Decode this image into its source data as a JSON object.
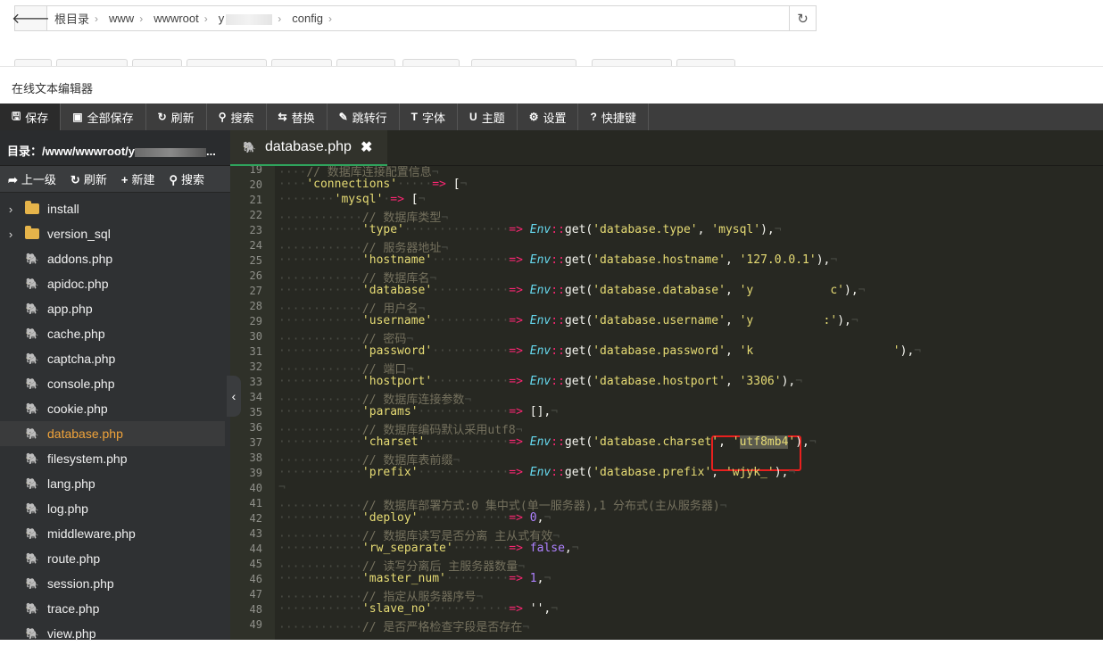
{
  "address_bar": {
    "breadcrumbs": [
      "根目录",
      "www",
      "wwwroot",
      "y",
      "config"
    ]
  },
  "modal": {
    "title": "在线文本编辑器"
  },
  "toolbar": {
    "buttons": [
      {
        "icon": "save-icon",
        "glyph": "🖫",
        "label": "保存"
      },
      {
        "icon": "save-all-icon",
        "glyph": "▣",
        "label": "全部保存"
      },
      {
        "icon": "refresh-icon",
        "glyph": "↻",
        "label": "刷新"
      },
      {
        "icon": "search-icon",
        "glyph": "⚲",
        "label": "搜索"
      },
      {
        "icon": "replace-icon",
        "glyph": "⇆",
        "label": "替换"
      },
      {
        "icon": "jump-icon",
        "glyph": "✎",
        "label": "跳转行"
      },
      {
        "icon": "font-icon",
        "glyph": "T",
        "label": "字体"
      },
      {
        "icon": "theme-icon",
        "glyph": "U",
        "label": "主题"
      },
      {
        "icon": "settings-icon",
        "glyph": "⚙",
        "label": "设置"
      },
      {
        "icon": "shortcut-icon",
        "glyph": "?",
        "label": "快捷键"
      }
    ]
  },
  "sidebar": {
    "dir_label": "目录：/www/wwwroot/y",
    "dir_ellipsis": "...",
    "actions": [
      {
        "icon": "up-icon",
        "glyph": "➦",
        "label": "上一级"
      },
      {
        "icon": "refresh-icon",
        "glyph": "↻",
        "label": "刷新"
      },
      {
        "icon": "plus-icon",
        "glyph": "+",
        "label": "新建"
      },
      {
        "icon": "search-icon",
        "glyph": "⚲",
        "label": "搜索"
      }
    ],
    "files": [
      {
        "name": "install",
        "type": "folder"
      },
      {
        "name": "version_sql",
        "type": "folder"
      },
      {
        "name": "addons.php",
        "type": "php"
      },
      {
        "name": "apidoc.php",
        "type": "php"
      },
      {
        "name": "app.php",
        "type": "php"
      },
      {
        "name": "cache.php",
        "type": "php"
      },
      {
        "name": "captcha.php",
        "type": "php"
      },
      {
        "name": "console.php",
        "type": "php"
      },
      {
        "name": "cookie.php",
        "type": "php"
      },
      {
        "name": "database.php",
        "type": "php",
        "selected": true
      },
      {
        "name": "filesystem.php",
        "type": "php"
      },
      {
        "name": "lang.php",
        "type": "php"
      },
      {
        "name": "log.php",
        "type": "php"
      },
      {
        "name": "middleware.php",
        "type": "php"
      },
      {
        "name": "route.php",
        "type": "php"
      },
      {
        "name": "session.php",
        "type": "php"
      },
      {
        "name": "trace.php",
        "type": "php"
      },
      {
        "name": "view.php",
        "type": "php"
      }
    ]
  },
  "editor": {
    "tab": {
      "label": "database.php",
      "close": "✖"
    },
    "highlighted_value": "utf8mb4",
    "lines": [
      {
        "n": "19",
        "indent": 4,
        "cm": "// 数据库连接配置信息"
      },
      {
        "n": "20",
        "indent": 4,
        "key": "'connections'",
        "pad": 5,
        "open": "["
      },
      {
        "n": "21",
        "indent": 8,
        "key": "'mysql'",
        "pad": 1,
        "open": "["
      },
      {
        "n": "22",
        "indent": 12,
        "cm": "// 数据库类型"
      },
      {
        "n": "23",
        "indent": 12,
        "key": "'type'",
        "pad": 15,
        "env": "database.type",
        "def": "'mysql'"
      },
      {
        "n": "24",
        "indent": 12,
        "cm": "// 服务器地址"
      },
      {
        "n": "25",
        "indent": 12,
        "key": "'hostname'",
        "pad": 11,
        "env": "database.hostname",
        "def": "'127.0.0.1'"
      },
      {
        "n": "26",
        "indent": 12,
        "cm": "// 数据库名"
      },
      {
        "n": "27",
        "indent": 12,
        "key": "'database'",
        "pad": 11,
        "env": "database.database",
        "def": "'y           c'"
      },
      {
        "n": "28",
        "indent": 12,
        "cm": "// 用户名"
      },
      {
        "n": "29",
        "indent": 12,
        "key": "'username'",
        "pad": 11,
        "env": "database.username",
        "def": "'y          :'"
      },
      {
        "n": "30",
        "indent": 12,
        "cm": "// 密码"
      },
      {
        "n": "31",
        "indent": 12,
        "key": "'password'",
        "pad": 11,
        "env": "database.password",
        "def": "'k                    '"
      },
      {
        "n": "32",
        "indent": 12,
        "cm": "// 端口"
      },
      {
        "n": "33",
        "indent": 12,
        "key": "'hostport'",
        "pad": 11,
        "env": "database.hostport",
        "def": "'3306'"
      },
      {
        "n": "34",
        "indent": 12,
        "cm": "// 数据库连接参数"
      },
      {
        "n": "35",
        "indent": 12,
        "key": "'params'",
        "pad": 13,
        "raw": "[],"
      },
      {
        "n": "36",
        "indent": 12,
        "cm": "// 数据库编码默认采用utf8"
      },
      {
        "n": "37",
        "indent": 12,
        "key": "'charset'",
        "pad": 12,
        "env": "database.charset",
        "def": "'utf8mb4'",
        "highlight": true
      },
      {
        "n": "38",
        "indent": 12,
        "cm": "// 数据库表前缀"
      },
      {
        "n": "39",
        "indent": 12,
        "key": "'prefix'",
        "pad": 13,
        "env": "database.prefix",
        "def": "'wjyk_'"
      },
      {
        "n": "40",
        "indent": 0,
        "empty": true
      },
      {
        "n": "41",
        "indent": 12,
        "cm": "// 数据库部署方式:0 集中式(单一服务器),1 分布式(主从服务器)"
      },
      {
        "n": "42",
        "indent": 12,
        "key": "'deploy'",
        "pad": 13,
        "num": "0"
      },
      {
        "n": "43",
        "indent": 12,
        "cm": "// 数据库读写是否分离 主从式有效"
      },
      {
        "n": "44",
        "indent": 12,
        "key": "'rw_separate'",
        "pad": 8,
        "bool": "false"
      },
      {
        "n": "45",
        "indent": 12,
        "cm": "// 读写分离后 主服务器数量"
      },
      {
        "n": "46",
        "indent": 12,
        "key": "'master_num'",
        "pad": 9,
        "num": "1"
      },
      {
        "n": "47",
        "indent": 12,
        "cm": "// 指定从服务器序号"
      },
      {
        "n": "48",
        "indent": 12,
        "key": "'slave_no'",
        "pad": 11,
        "raw": "'',"
      },
      {
        "n": "49",
        "indent": 12,
        "cm": "// 是否严格检查字段是否存在"
      }
    ]
  }
}
